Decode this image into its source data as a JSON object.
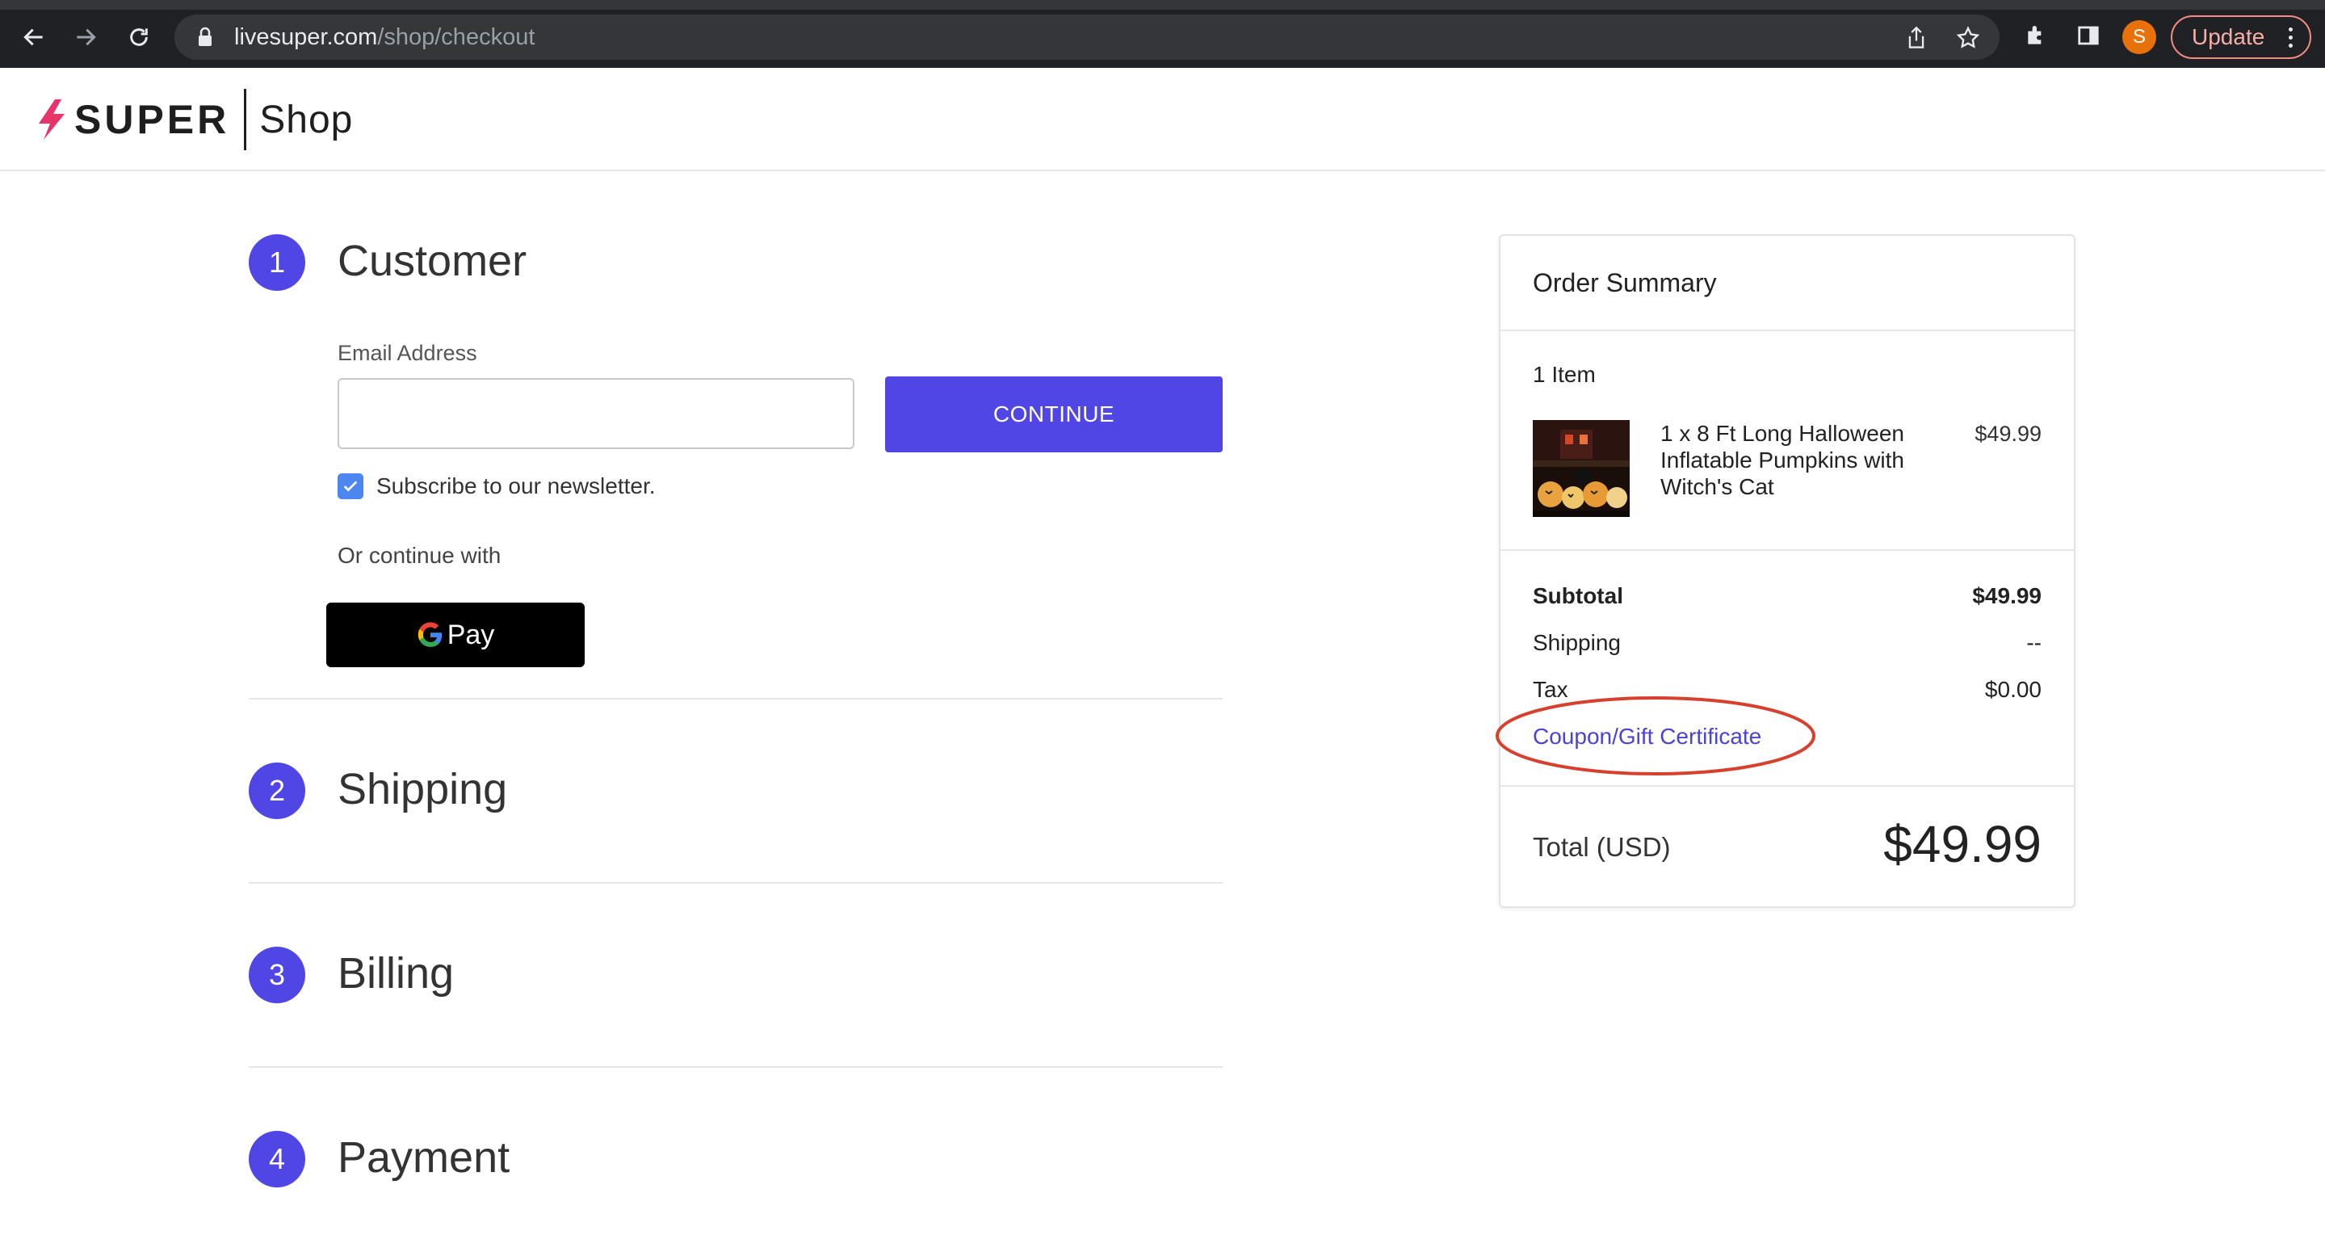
{
  "browser": {
    "url_host": "livesuper.com",
    "url_path": "/shop/checkout",
    "avatar_letter": "S",
    "update_label": "Update"
  },
  "header": {
    "logo_text": "SUPER",
    "logo_sub": "Shop"
  },
  "steps": [
    {
      "number": "1",
      "title": "Customer"
    },
    {
      "number": "2",
      "title": "Shipping"
    },
    {
      "number": "3",
      "title": "Billing"
    },
    {
      "number": "4",
      "title": "Payment"
    }
  ],
  "customer": {
    "email_label": "Email Address",
    "email_value": "",
    "continue_label": "CONTINUE",
    "newsletter_label": "Subscribe to our newsletter.",
    "newsletter_checked": true,
    "or_continue": "Or continue with",
    "gpay_label": "Pay"
  },
  "summary": {
    "title": "Order Summary",
    "items_count": "1 Item",
    "product_name": "1 x 8 Ft Long Halloween Inflatable Pumpkins with Witch's Cat",
    "product_price": "$49.99",
    "subtotal_label": "Subtotal",
    "subtotal_value": "$49.99",
    "shipping_label": "Shipping",
    "shipping_value": "--",
    "tax_label": "Tax",
    "tax_value": "$0.00",
    "coupon_label": "Coupon/Gift Certificate",
    "total_label": "Total (USD)",
    "total_value": "$49.99"
  },
  "colors": {
    "accent": "#5046e5",
    "annotation": "#d8402e",
    "link": "#4a43d8"
  }
}
